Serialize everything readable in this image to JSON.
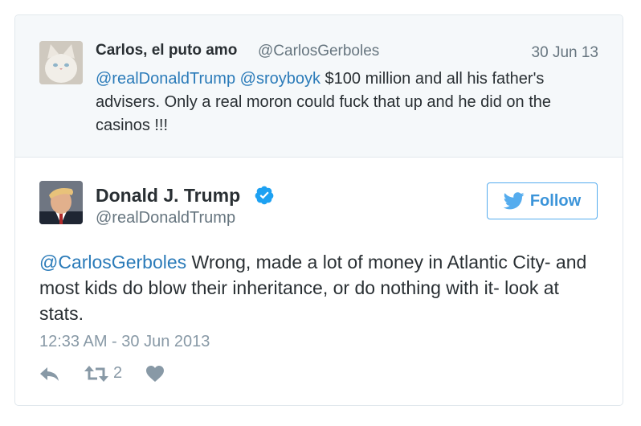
{
  "parent_tweet": {
    "author_name": "Carlos, el puto amo",
    "author_handle": "@CarlosGerboles",
    "date": "30 Jun 13",
    "mention_1": "@realDonaldTrump",
    "mention_2": "@sroyboyk",
    "text": "$100 million and all his father's advisers. Only a real moron could fuck that up and he did on the casinos !!!"
  },
  "main_tweet": {
    "author_name": "Donald J. Trump",
    "author_handle": "@realDonaldTrump",
    "verified": true,
    "follow_label": "Follow",
    "mention": "@CarlosGerboles",
    "text": "Wrong, made a lot of money in Atlantic City- and most kids do blow their inheritance, or do nothing with it- look at stats.",
    "timestamp": "12:33 AM - 30 Jun 2013",
    "retweet_count": "2"
  },
  "icons": {
    "reply": "reply-icon",
    "retweet": "retweet-icon",
    "like": "heart-icon",
    "verified": "verified-badge-icon",
    "follow": "twitter-bird-icon"
  },
  "colors": {
    "link": "#2b7bb9",
    "follow": "#3b94d9",
    "verified": "#1da1f2",
    "muted": "#8899a6",
    "parent_background": "#f5f8fa"
  }
}
